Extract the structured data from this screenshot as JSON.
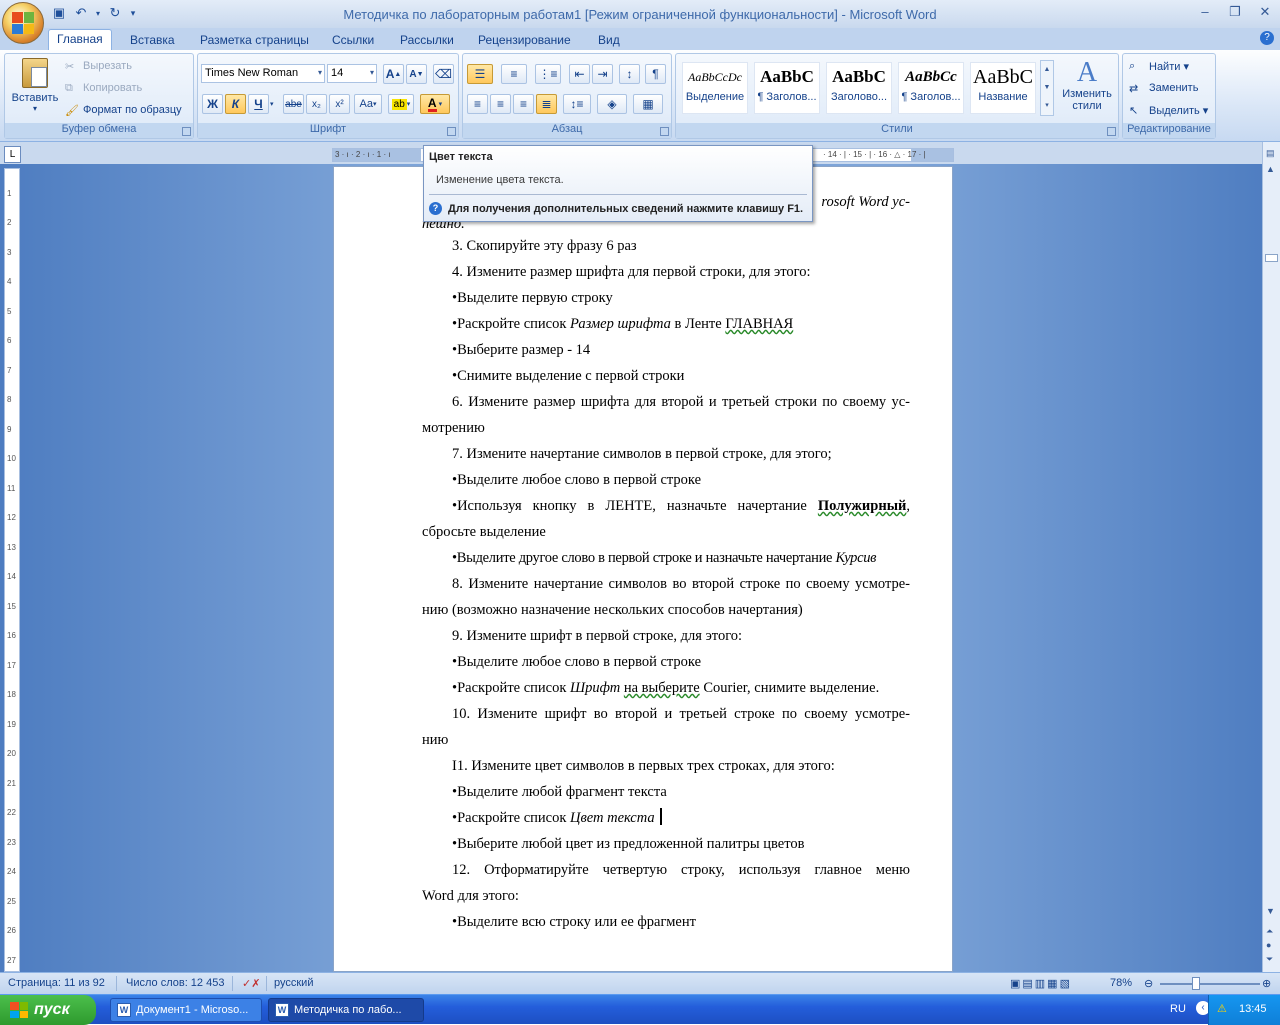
{
  "window": {
    "title": "Методичка по лабораторным работам1 [Режим ограниченной функциональности] - Microsoft Word"
  },
  "tabs": [
    "Главная",
    "Вставка",
    "Разметка страницы",
    "Ссылки",
    "Рассылки",
    "Рецензирование",
    "Вид"
  ],
  "clipboard": {
    "paste": "Вставить",
    "cut": "Вырезать",
    "copy": "Копировать",
    "format_painter": "Формат по образцу",
    "label": "Буфер обмена"
  },
  "font": {
    "name": "Times New Roman",
    "size": "14",
    "label": "Шрифт",
    "bold": "Ж",
    "italic": "К",
    "underline": "Ч",
    "strike": "abe",
    "sub": "x₂",
    "sup": "x²",
    "case": "Aa",
    "grow": "A",
    "shrink": "A",
    "color_btn": "A"
  },
  "paragraph": {
    "label": "Абзац"
  },
  "styles": {
    "label": "Стили",
    "items": [
      {
        "preview": "AaBbCcDc",
        "name": "Выделение"
      },
      {
        "preview": "AaBbC",
        "name": "¶ Заголов..."
      },
      {
        "preview": "AaBbC",
        "name": "Заголово..."
      },
      {
        "preview": "AaBbCc",
        "name": "¶ Заголов..."
      },
      {
        "preview": "AaBbC",
        "name": "Название"
      }
    ],
    "change": "Изменить стили"
  },
  "editing": {
    "find": "Найти",
    "replace": "Заменить",
    "select": "Выделить",
    "label": "Редактирование"
  },
  "tooltip": {
    "title": "Цвет текста",
    "description": "Изменение цвета текста.",
    "help": "Для получения дополнительных сведений нажмите клавишу F1."
  },
  "document": {
    "l0_right": "rosoft Word ус-",
    "l0b": "пешно.",
    "l1": "3.  Скопируйте эту фразу 6 раз",
    "l2": "4.  Измените размер шрифта для первой строки, для этого:",
    "l3": "•Выделите первую строку",
    "l4a": "•Раскройте список ",
    "l4b": "Размер шрифта",
    "l4c": " в Ленте ",
    "l4d": "ГЛАВНАЯ",
    "l5": "•Выберите размер - 14",
    "l6": "•Снимите выделение с первой строки",
    "l7": "6.  Измените размер шрифта для второй и третьей строки по своему ус-",
    "l7b": "мотрению",
    "l8": "7.  Измените начертание символов в первой строке, для этого;",
    "l9": "•Выделите любое слово в первой строке",
    "l10a": "•Используя кнопку в ЛЕНТЕ, назначьте начертание ",
    "l10b": "Полужирный",
    "l10c": ",",
    "l10d": "сбросьте выделение",
    "l11a": "•Выделите другое слово в первой строке и назначьте начертание ",
    "l11b": "Курсив",
    "l12": "8.  Измените начертание символов во второй строке по своему усмотре-",
    "l12b": "нию (возможно назначение нескольких способов начертания)",
    "l13": "9.  Измените шрифт в первой строке, для этого:",
    "l14": "•Выделите любое слово в первой строке",
    "l15a": "•Раскройте список ",
    "l15b": "Шрифт",
    "l15c": " ",
    "l15d": "на выберите",
    "l15e": " Courier, снимите выделение.",
    "l16": "10.       Измените шрифт во второй и третьей строке по своему усмотре-",
    "l16b": "нию",
    "l17": "I1.       Измените цвет символов в первых трех строках, для этого:",
    "l18": "•Выделите любой фрагмент текста",
    "l19a": "•Раскройте список ",
    "l19b": "Цвет текста",
    "l20": "•Выберите любой цвет из предложенной палитры цветов",
    "l21": "12.       Отформатируйте четвертую строку, используя главное меню",
    "l21b": "Word для этого:",
    "l22": "•Выделите всю строку или ее фрагмент"
  },
  "status": {
    "page": "Страница: 11 из 92",
    "words": "Число слов: 12 453",
    "lang": "русский",
    "zoom": "78%"
  },
  "taskbar": {
    "start": "пуск",
    "btn1": "Документ1 - Microso...",
    "btn2": "Методичка по лабо...",
    "lang": "RU",
    "time": "13:45"
  },
  "colors": {
    "accent": "#15428b",
    "ribbon_bg": "#dbe7f7",
    "workspace": "#6f97cf",
    "taskbar": "#245edb",
    "start": "#2e9a2e",
    "font_color_red": "#e02020",
    "highlight_yellow": "#f7e400"
  }
}
